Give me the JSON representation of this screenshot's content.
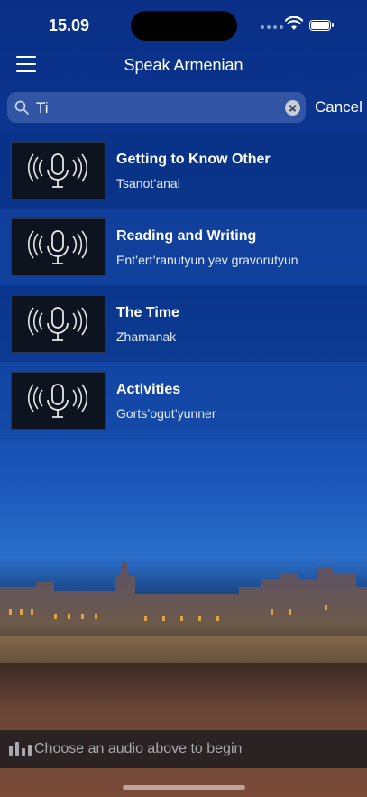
{
  "status_bar": {
    "time": "15.09"
  },
  "nav": {
    "title": "Speak Armenian"
  },
  "search": {
    "value": "Ti",
    "cancel_label": "Cancel"
  },
  "lessons": [
    {
      "title": "Getting to Know Other",
      "subtitle": "Tsanot’anal"
    },
    {
      "title": "Reading and Writing",
      "subtitle": "Ent’ert’ranutyun yev gravorutyun"
    },
    {
      "title": "The Time",
      "subtitle": "Zhamanak"
    },
    {
      "title": "Activities",
      "subtitle": "Gorts’ogut’yunner"
    }
  ],
  "player": {
    "text": "Choose an audio above to begin"
  },
  "icons": {
    "menu": "hamburger-icon",
    "search": "search-icon",
    "clear": "clear-icon",
    "thumb": "microphone-icon",
    "player": "equalizer-icon"
  }
}
